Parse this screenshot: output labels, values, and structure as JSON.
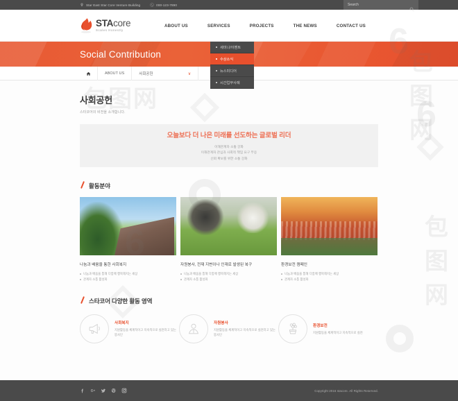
{
  "topbar": {
    "address": "Star East Star Core Venture Building",
    "phone": "000-123-7890",
    "search_placeholder": "Search"
  },
  "brand": {
    "name_bold": "STA",
    "name_light": "core",
    "tagline": "Scales Honestly"
  },
  "nav": [
    {
      "label": "ABOUT US",
      "active": false
    },
    {
      "label": "SERVICES",
      "active": true
    },
    {
      "label": "PROJECTS",
      "active": false
    },
    {
      "label": "THE NEWS",
      "active": false
    },
    {
      "label": "CONTACT US",
      "active": false
    }
  ],
  "dropdown": [
    {
      "label": "세미나/이벤트",
      "selected": false
    },
    {
      "label": "수상소식",
      "selected": true
    },
    {
      "label": "뉴스미디어",
      "selected": false
    },
    {
      "label": "시간업무사례",
      "selected": false
    }
  ],
  "hero": {
    "title": "Social Contribution"
  },
  "breadcrumb": {
    "home_icon": "home-icon",
    "level1": "ABOUT US",
    "level2": "사회공헌",
    "chevron": "∨"
  },
  "page": {
    "title": "사회공헌",
    "subtitle": "스타코어의 비전을 소개합니다."
  },
  "panel": {
    "headline": "오늘보다 더 나은 미래를 선도하는 글로벌 리더",
    "lines": [
      "이해관계자 소통 강화",
      "이해관계자 관심과 사회적 책임 요구 부응",
      "신뢰 확보를 위한 소통 강화"
    ]
  },
  "section_activity": {
    "heading": "활동분야"
  },
  "cards": [
    {
      "title": "나눔과 배움을 통한 사회복지",
      "bullets": [
        "나눔과 배움을 통해 다함께 행복해지는 세상",
        "관계자 소통 활성화"
      ]
    },
    {
      "title": "자원봉사, 전재 지변이나 인재로 발생된 복구",
      "bullets": [
        "나눔과 배움을 통해 다함께 행복해지는 세상",
        "관계자 소통 활성화"
      ]
    },
    {
      "title": "환경보전 캠페인",
      "bullets": [
        "나눔과 배움을 통해 다함께 행복해지는 세상",
        "관계자 소통 활성화"
      ]
    }
  ],
  "section_areas": {
    "heading": "스타코어 다양한 활동 영역"
  },
  "features": [
    {
      "icon": "megaphone-icon",
      "title": "사회복지",
      "desc": "지원활동을 체계적이고 지속적으로 실천하고 있는 봉사단"
    },
    {
      "icon": "person-icon",
      "title": "자원봉사",
      "desc": "지원활동을 체계적이고 지속적으로 실천하고 있는 봉사단"
    },
    {
      "icon": "plant-pot-icon",
      "title": "환경보전",
      "desc": "지원활동을 체계적이고 지속적으로 실천"
    }
  ],
  "footer": {
    "socials": [
      "facebook-icon",
      "google-plus-icon",
      "twitter-icon",
      "pinterest-icon",
      "instagram-icon"
    ],
    "copyright": "Copyright 2016 stacore. All Rights Reserved."
  },
  "colors": {
    "accent": "#e8502d",
    "dark": "#4a4a4a",
    "panel": "#f1f1f1"
  },
  "watermark": {
    "text": "包图网",
    "digit": "6"
  }
}
